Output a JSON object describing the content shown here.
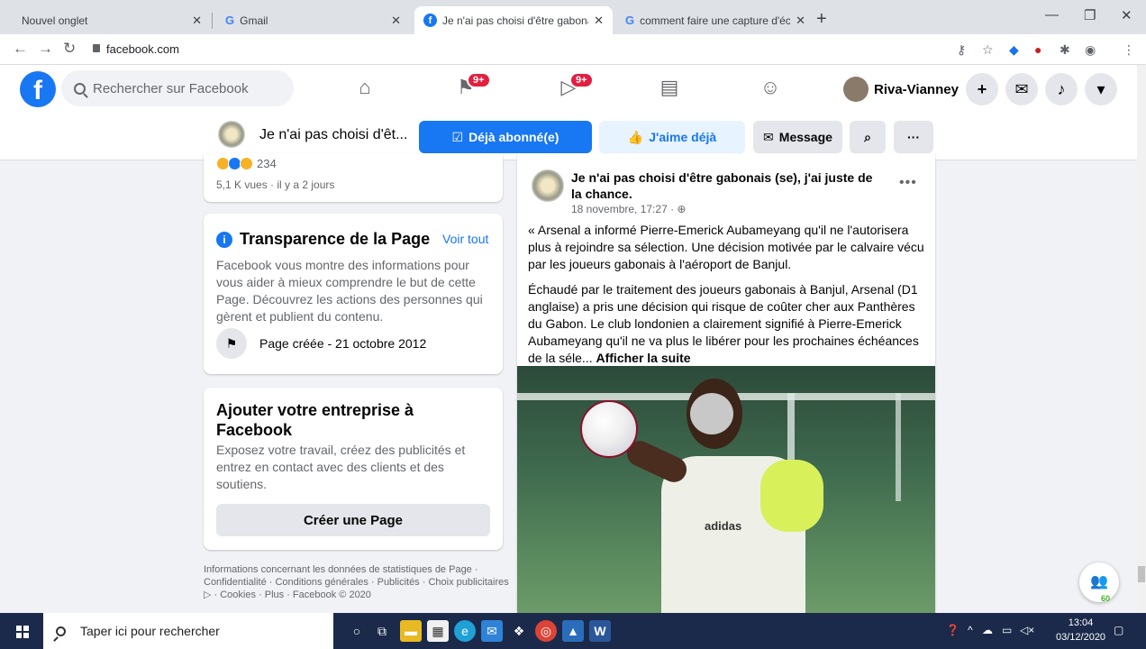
{
  "browser": {
    "tabs": [
      {
        "label": "Nouvel onglet"
      },
      {
        "label": "Gmail"
      },
      {
        "label": "Je n'ai pas choisi d'être gabonais"
      },
      {
        "label": "comment faire une capture d'écr"
      }
    ],
    "url": "facebook.com"
  },
  "fb": {
    "search_placeholder": "Rechercher sur Facebook",
    "badge_pages": "9+",
    "badge_watch": "9+",
    "profile_name": "Riva-Vianney"
  },
  "page_header": {
    "name": "Je n'ai pas choisi d'êt...",
    "subscribed": "Déjà abonné(e)",
    "liked": "J'aime déjà",
    "message": "Message"
  },
  "left": {
    "reactions_count": "234",
    "views": "5,1 K vues · il y a 2 jours",
    "transparency_title": "Transparence de la Page",
    "see_all": "Voir tout",
    "transparency_text": "Facebook vous montre des informations pour vous aider à mieux comprendre le but de cette Page. Découvrez les actions des personnes qui gèrent et publient du contenu.",
    "page_created": "Page créée - 21 octobre 2012",
    "biz_title": "Ajouter votre entreprise à Facebook",
    "biz_text": "Exposez votre travail, créez des publicités et entrez en contact avec des clients et des soutiens.",
    "biz_button": "Créer une Page",
    "footer": "Informations concernant les données de statistiques de Page · Confidentialité · Conditions générales · Publicités · Choix publicitaires ▷ · Cookies · Plus · Facebook © 2020"
  },
  "post": {
    "author": "Je n'ai pas choisi d'être gabonais (se), j'ai juste de la chance.",
    "meta": "18 novembre, 17:27 ·",
    "para1": "« Arsenal a informé Pierre-Emerick Aubameyang qu'il ne l'autorisera plus à rejoindre  sa sélection. Une décision motivée par le calvaire vécu par les joueurs gabonais à l'aéroport de Banjul.",
    "para2": "Échaudé par le traitement des joueurs gabonais à Banjul, Arsenal (D1 anglaise) a pris une décision qui risque de coûter cher aux Panthères du Gabon. Le club londonien a clairement signifié à Pierre-Emerick Aubameyang qu'il ne va plus le libérer pour les prochaines échéances de la séle...",
    "see_more": "Afficher la suite",
    "photo_brand": "adidas"
  },
  "contacts_count": "60",
  "taskbar": {
    "search_placeholder": "Taper ici pour rechercher",
    "time": "13:04",
    "date": "03/12/2020"
  }
}
